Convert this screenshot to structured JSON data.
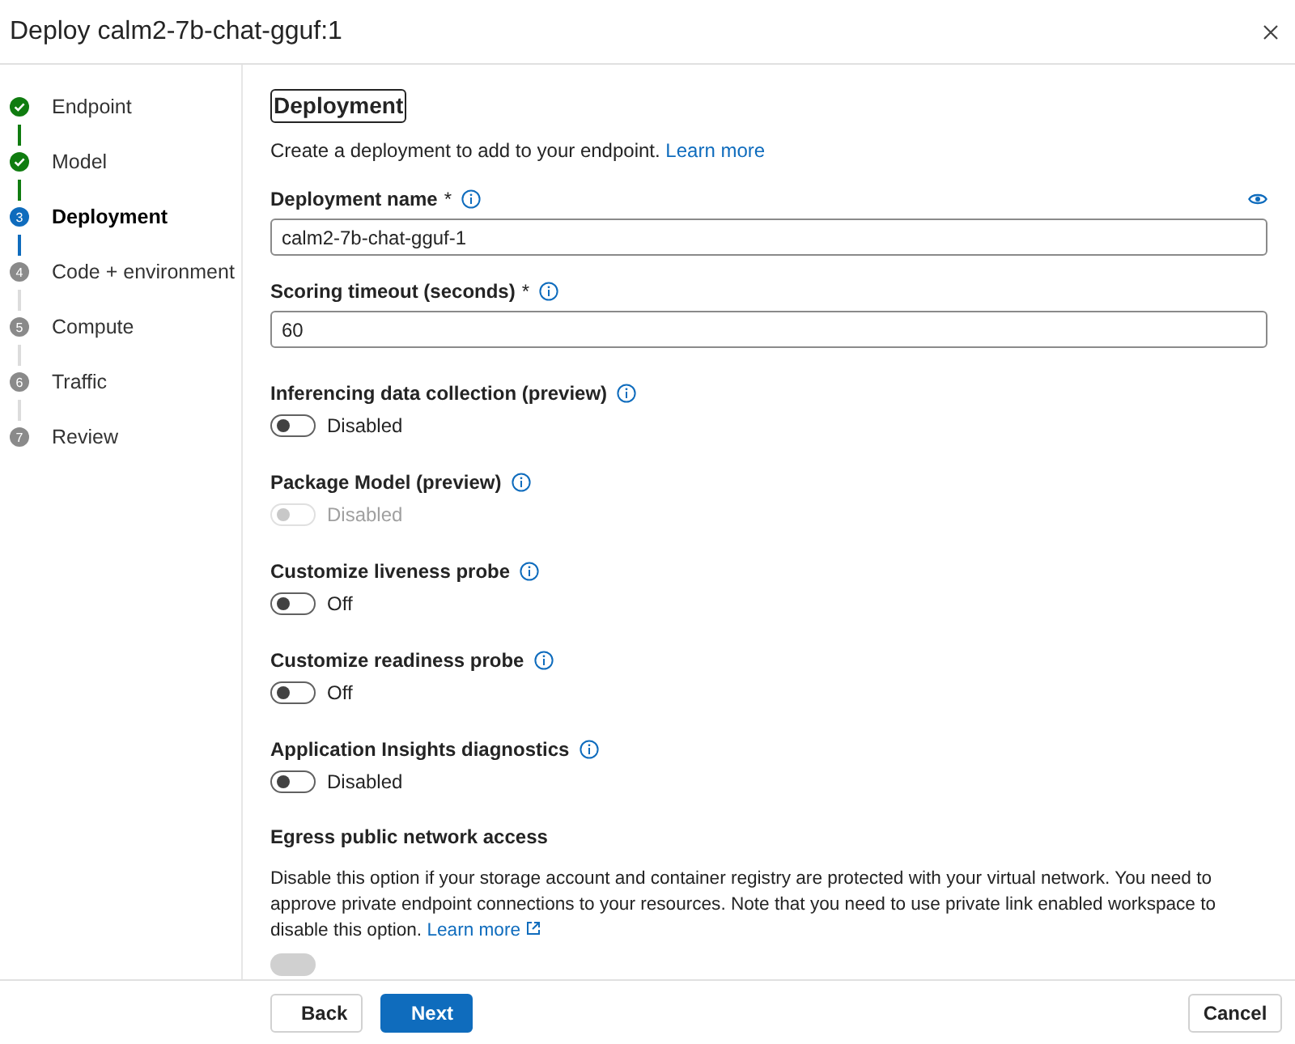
{
  "window": {
    "title": "Deploy calm2-7b-chat-gguf:1"
  },
  "steps": [
    {
      "label": "Endpoint",
      "completed": true,
      "selected": false
    },
    {
      "label": "Model",
      "completed": true,
      "selected": false
    },
    {
      "number": "3",
      "label": "Deployment",
      "completed": false,
      "selected": true
    },
    {
      "number": "4",
      "label": "Code + environment",
      "completed": false,
      "selected": false
    },
    {
      "number": "5",
      "label": "Compute",
      "completed": false,
      "selected": false
    },
    {
      "number": "6",
      "label": "Traffic",
      "completed": false,
      "selected": false
    },
    {
      "number": "7",
      "label": "Review",
      "completed": false,
      "selected": false
    }
  ],
  "section": {
    "heading": "Deployment",
    "description": "Create a deployment to add to your endpoint.",
    "link": "Learn more"
  },
  "fields": [
    {
      "label": "Deployment name",
      "required_mark": "*",
      "value": "calm2-7b-chat-gguf-1",
      "reveal_icon": true
    },
    {
      "label": "Scoring timeout (seconds)",
      "required_mark": "*",
      "value": "60",
      "reveal_icon": false
    }
  ],
  "toggles": [
    {
      "label": "Inferencing data collection (preview)",
      "on": false,
      "disabled": false,
      "state_text": "Disabled"
    },
    {
      "label": "Package Model (preview)",
      "on": false,
      "disabled": true,
      "state_text": "Disabled"
    },
    {
      "label": "Customize liveness probe",
      "on": false,
      "disabled": false,
      "state_text": "Off"
    },
    {
      "label": "Customize readiness probe",
      "on": false,
      "disabled": false,
      "state_text": "Off"
    },
    {
      "label": "Application Insights diagnostics",
      "on": false,
      "disabled": false,
      "state_text": "Disabled"
    }
  ],
  "egress": {
    "heading": "Egress public network access",
    "description": "Disable this option if your storage account and container registry are protected with your virtual network. You need to approve private endpoint connections to your resources. Note that you need to use private link enabled workspace to disable this option.",
    "link": "Learn more",
    "toggle_disabled": true
  },
  "footer": {
    "buttons": [
      "Back",
      "Next"
    ],
    "cancel": "Cancel"
  }
}
